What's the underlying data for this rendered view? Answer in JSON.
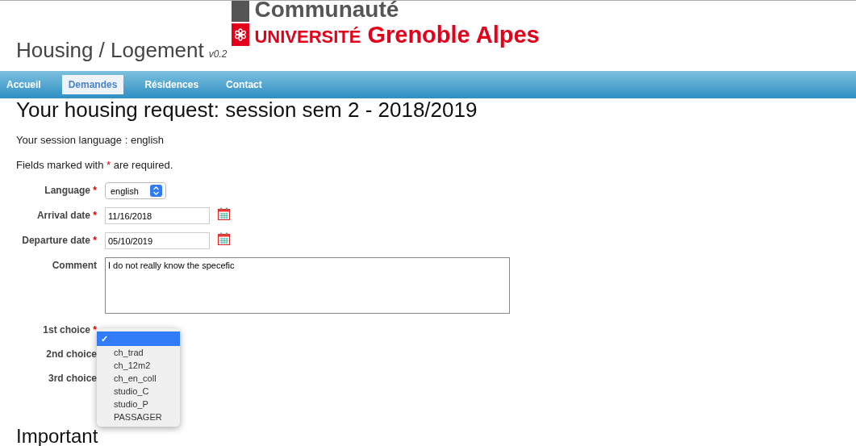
{
  "logo": {
    "line1": "Communauté",
    "line2a": "UNIVERSITÉ",
    "line2b": "Grenoble Alpes"
  },
  "app_title": {
    "name": "Housing / Logement",
    "version": "v0.2"
  },
  "nav": [
    {
      "label": "Accueil",
      "selected": false
    },
    {
      "label": "Demandes",
      "selected": true
    },
    {
      "label": "Résidences",
      "selected": false
    },
    {
      "label": "Contact",
      "selected": false
    }
  ],
  "heading": "Your housing request: session sem 2 - 2018/2019",
  "session_language": "Your session language : english",
  "required_note": {
    "before": "Fields marked with",
    "mark": "*",
    "after": "are required."
  },
  "fields": [
    {
      "kind": "select",
      "label": "Language",
      "required": true,
      "value": "english"
    },
    {
      "kind": "date",
      "label": "Arrival date",
      "required": true,
      "value": "11/16/2018"
    },
    {
      "kind": "date",
      "label": "Departure date",
      "required": true,
      "value": "05/10/2019"
    },
    {
      "kind": "textarea",
      "label": "Comment",
      "required": false,
      "value": "I do not really know the specefic"
    },
    {
      "kind": "choice",
      "label": "1st choice",
      "required": true
    },
    {
      "kind": "choice",
      "label": "2nd choice",
      "required": false
    },
    {
      "kind": "choice",
      "label": "3rd choice",
      "required": false
    }
  ],
  "choice_menu": [
    {
      "label": "✓",
      "selected": true
    },
    {
      "label": "ch_trad",
      "selected": false
    },
    {
      "label": "ch_12m2",
      "selected": false
    },
    {
      "label": "ch_en_coll",
      "selected": false
    },
    {
      "label": "studio_C",
      "selected": false
    },
    {
      "label": "studio_P",
      "selected": false
    },
    {
      "label": "PASSAGER",
      "selected": false
    }
  ],
  "section_heading": "Important"
}
